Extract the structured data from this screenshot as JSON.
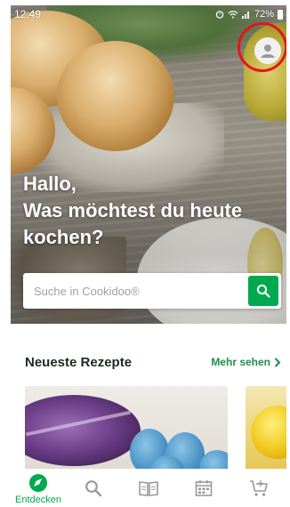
{
  "status_bar": {
    "time": "12:49",
    "battery": "72%"
  },
  "hero": {
    "greeting_line1": "Hallo,",
    "greeting_line2": "Was möchtest du heute",
    "greeting_line3": "kochen?"
  },
  "search": {
    "placeholder": "Suche in Cookidoo®",
    "value": ""
  },
  "section": {
    "title": "Neueste Rezepte",
    "more_label": "Mehr sehen"
  },
  "nav": {
    "items": [
      {
        "label": "Entdecken",
        "icon": "compass-icon",
        "active": true
      },
      {
        "label": "",
        "icon": "search-icon",
        "active": false
      },
      {
        "label": "",
        "icon": "book-icon",
        "active": false
      },
      {
        "label": "",
        "icon": "calendar-icon",
        "active": false
      },
      {
        "label": "",
        "icon": "shopping-cart-icon",
        "active": false
      }
    ]
  },
  "colors": {
    "accent": "#00a94f",
    "annotation": "#e8131a",
    "nav_icon": "#9a9a9a"
  }
}
